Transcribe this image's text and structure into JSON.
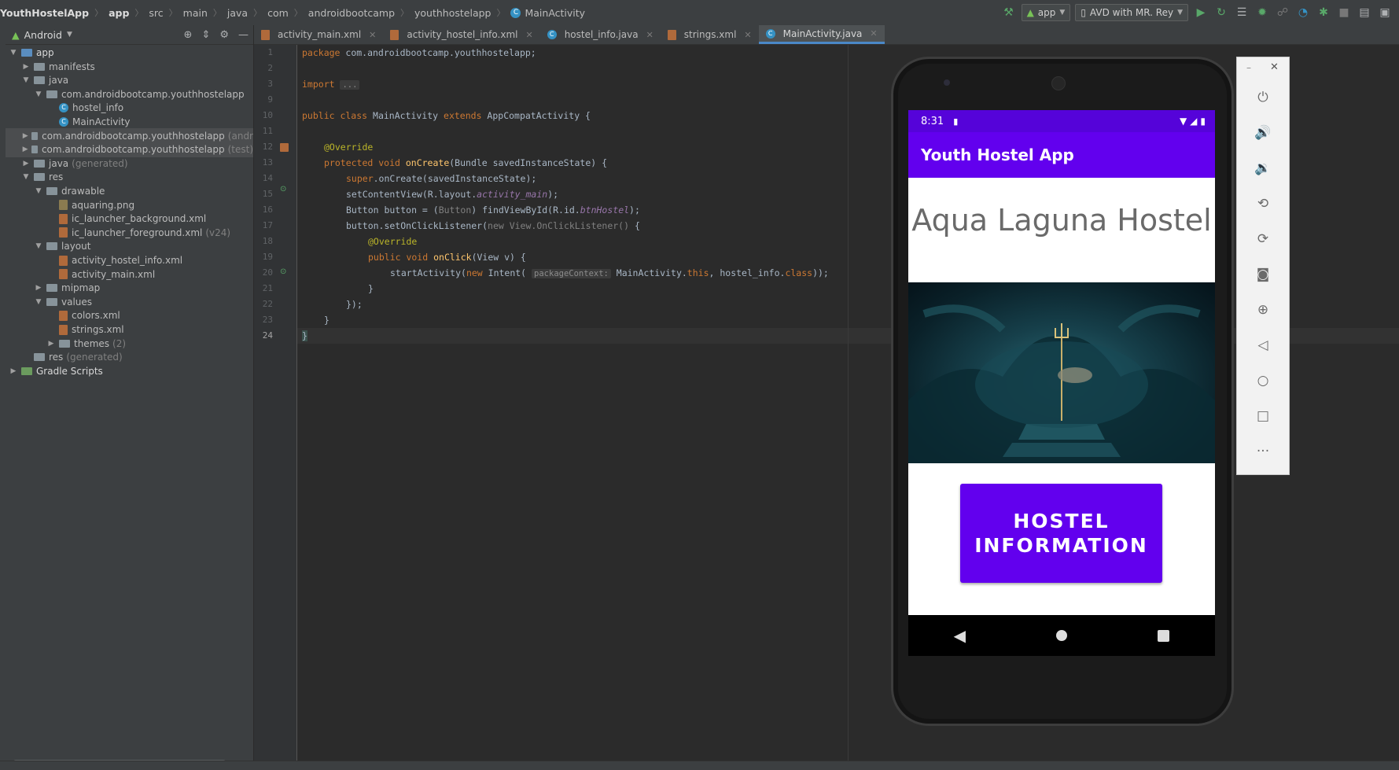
{
  "breadcrumb": {
    "items": [
      "YouthHostelApp",
      "app",
      "src",
      "main",
      "java",
      "com",
      "androidbootcamp",
      "youthhostelapp",
      "MainActivity"
    ]
  },
  "toolbar": {
    "module": "app",
    "device": "AVD with MR. Rey"
  },
  "project_panel": {
    "view": "Android",
    "tree": [
      {
        "label": "app",
        "depth": 0,
        "open": true,
        "icon": "module-folder-icon"
      },
      {
        "label": "manifests",
        "depth": 1,
        "open": false,
        "icon": "folder-icon"
      },
      {
        "label": "java",
        "depth": 1,
        "open": true,
        "icon": "folder-icon"
      },
      {
        "label": "com.androidbootcamp.youthhostelapp",
        "depth": 2,
        "open": true,
        "icon": "package-icon"
      },
      {
        "label": "hostel_info",
        "depth": 3,
        "icon": "class-icon"
      },
      {
        "label": "MainActivity",
        "depth": 3,
        "icon": "class-icon"
      },
      {
        "label": "com.androidbootcamp.youthhostelapp",
        "suffix": "(andr",
        "depth": 2,
        "open": false,
        "icon": "package-icon",
        "sel": true
      },
      {
        "label": "com.androidbootcamp.youthhostelapp",
        "suffix": "(test)",
        "depth": 2,
        "open": false,
        "icon": "package-icon",
        "sel": true
      },
      {
        "label": "java",
        "suffix": "(generated)",
        "depth": 1,
        "open": false,
        "icon": "folder-icon"
      },
      {
        "label": "res",
        "depth": 1,
        "open": true,
        "icon": "folder-icon"
      },
      {
        "label": "drawable",
        "depth": 2,
        "open": true,
        "icon": "folder-icon"
      },
      {
        "label": "aquaring.png",
        "depth": 3,
        "icon": "png-file-icon"
      },
      {
        "label": "ic_launcher_background.xml",
        "depth": 3,
        "icon": "xml-file-icon"
      },
      {
        "label": "ic_launcher_foreground.xml",
        "suffix": "(v24)",
        "depth": 3,
        "icon": "xml-file-icon"
      },
      {
        "label": "layout",
        "depth": 2,
        "open": true,
        "icon": "folder-icon"
      },
      {
        "label": "activity_hostel_info.xml",
        "depth": 3,
        "icon": "xml-file-icon"
      },
      {
        "label": "activity_main.xml",
        "depth": 3,
        "icon": "xml-file-icon"
      },
      {
        "label": "mipmap",
        "depth": 2,
        "open": false,
        "icon": "folder-icon"
      },
      {
        "label": "values",
        "depth": 2,
        "open": true,
        "icon": "folder-icon"
      },
      {
        "label": "colors.xml",
        "depth": 3,
        "icon": "xml-file-icon"
      },
      {
        "label": "strings.xml",
        "depth": 3,
        "icon": "xml-file-icon"
      },
      {
        "label": "themes",
        "suffix": "(2)",
        "depth": 3,
        "open": false,
        "icon": "folder-icon"
      },
      {
        "label": "res",
        "suffix": "(generated)",
        "depth": 1,
        "icon": "folder-icon"
      },
      {
        "label": "Gradle Scripts",
        "depth": 0,
        "open": false,
        "icon": "gradle-icon"
      }
    ]
  },
  "tabs": [
    {
      "label": "activity_main.xml",
      "icon": "xml-file-icon"
    },
    {
      "label": "activity_hostel_info.xml",
      "icon": "xml-file-icon"
    },
    {
      "label": "hostel_info.java",
      "icon": "class-icon"
    },
    {
      "label": "strings.xml",
      "icon": "xml-file-icon"
    },
    {
      "label": "MainActivity.java",
      "icon": "class-icon",
      "active": true
    }
  ],
  "line_numbers": [
    "1",
    "2",
    "3",
    "9",
    "10",
    "11",
    "12",
    "13",
    "14",
    "15",
    "16",
    "17",
    "18",
    "19",
    "20",
    "21",
    "22",
    "23",
    "24"
  ],
  "code": {
    "l1_kw": "package ",
    "l1_rest": "com.androidbootcamp.youthhostelapp;",
    "l3_kw": "import ",
    "l3_fold": "...",
    "l10_kw": "public class ",
    "l10_name": "MainActivity ",
    "l10_kw2": "extends ",
    "l10_rest": "AppCompatActivity {",
    "l13_an": "@Override",
    "l14_kw": "protected void ",
    "l14_fn": "onCreate",
    "l14_rest": "(Bundle savedInstanceState) {",
    "l15_kw": "super",
    "l15_rest": ".onCreate(savedInstanceState);",
    "l16_a": "setContentView(R.layout.",
    "l16_it": "activity_main",
    "l16_b": ");",
    "l17_a": "Button button = (",
    "l17_cm": "Button",
    "l17_b": ") findViewById(R.id.",
    "l17_it": "btnHostel",
    "l17_c": ");",
    "l18_a": "button.setOnClickListener(",
    "l18_cm": "new View.OnClickListener() ",
    "l18_b": "{",
    "l19_an": "@Override",
    "l20_kw": "public void ",
    "l20_fn": "onClick",
    "l20_rest": "(View v) {",
    "l21_a": "startActivity(",
    "l21_kw": "new ",
    "l21_b": "Intent( ",
    "l21_hint": "packageContext:",
    "l21_c": " MainActivity.",
    "l21_kw2": "this",
    "l21_d": ", hostel_info.",
    "l21_kw3": "class",
    "l21_e": "));",
    "l22": "}",
    "l23": "});",
    "l24": "}",
    "l25": "}"
  },
  "emulator": {
    "time": "8:31",
    "app_title": "Youth Hostel App",
    "heading": "Aqua Laguna Hostel",
    "button_label": "HOSTEL INFORMATION",
    "accent": "#6200ee",
    "status_color": "#5503d9"
  }
}
